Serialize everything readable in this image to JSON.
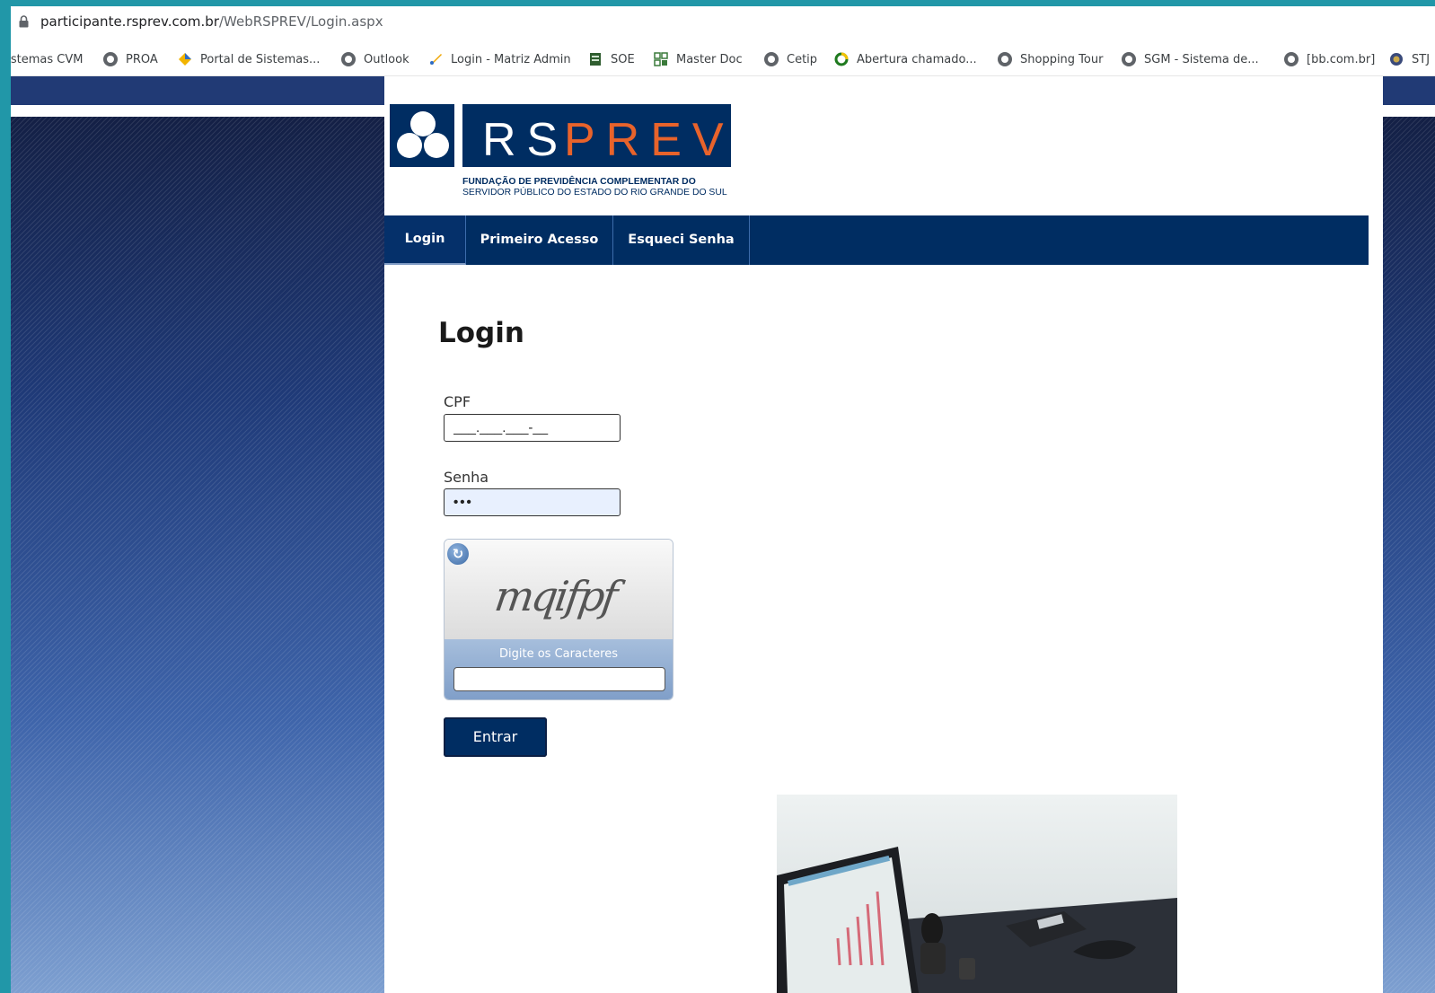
{
  "browser": {
    "url_host": "participante.rsprev.com.br",
    "url_path": "/WebRSPREV/Login.aspx",
    "bookmarks": [
      {
        "label": "Sistemas CVM",
        "icon": "none"
      },
      {
        "label": "PROA",
        "icon": "globe-icon"
      },
      {
        "label": "Portal de Sistemas...",
        "icon": "diamond-icon"
      },
      {
        "label": "Outlook",
        "icon": "globe-icon"
      },
      {
        "label": "Login - Matriz Admin",
        "icon": "brush-icon"
      },
      {
        "label": "SOE",
        "icon": "document-icon"
      },
      {
        "label": "Master Doc",
        "icon": "grid-icon"
      },
      {
        "label": "Cetip",
        "icon": "globe-icon"
      },
      {
        "label": "Abertura chamado...",
        "icon": "ring-icon"
      },
      {
        "label": "Shopping Tour",
        "icon": "globe-icon"
      },
      {
        "label": "SGM - Sistema de...",
        "icon": "globe-icon"
      },
      {
        "label": "[bb.com.br]",
        "icon": "globe-icon"
      },
      {
        "label": "STJ",
        "icon": "seal-icon"
      }
    ]
  },
  "logo": {
    "brand_rs": "RS",
    "brand_prev": "PREV",
    "tagline_line1": "FUNDAÇÃO DE PREVIDÊNCIA COMPLEMENTAR DO",
    "tagline_line2": "SERVIDOR PÚBLICO DO ESTADO DO RIO GRANDE DO SUL"
  },
  "nav": {
    "tabs": [
      "Login",
      "Primeiro Acesso",
      "Esqueci Senha"
    ]
  },
  "colors": {
    "brand_blue": "#002d62",
    "brand_orange": "#e8632b",
    "accent_teal": "#2197a8"
  },
  "form": {
    "title": "Login",
    "cpf_label": "CPF",
    "cpf_value": "___.___.___-__",
    "senha_label": "Senha",
    "senha_value": "•••",
    "captcha_text": "mqifpf",
    "captcha_label": "Digite os Caracteres",
    "submit_label": "Entrar"
  }
}
